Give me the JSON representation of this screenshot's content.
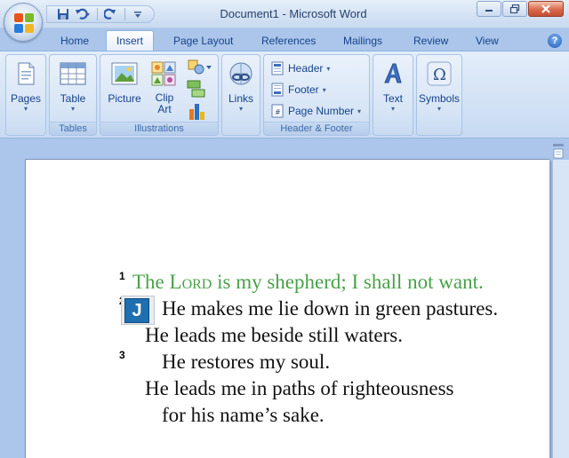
{
  "window": {
    "title": "Document1 - Microsoft Word"
  },
  "tabs": [
    {
      "label": "Home"
    },
    {
      "label": "Insert"
    },
    {
      "label": "Page Layout"
    },
    {
      "label": "References"
    },
    {
      "label": "Mailings"
    },
    {
      "label": "Review"
    },
    {
      "label": "View"
    }
  ],
  "active_tab": "Insert",
  "help": {
    "label": "?"
  },
  "ribbon": {
    "pages": {
      "label": "Pages"
    },
    "tables": {
      "table_label": "Table",
      "group_label": "Tables"
    },
    "illustrations": {
      "picture_label": "Picture",
      "clipart_line1": "Clip",
      "clipart_line2": "Art",
      "group_label": "Illustrations"
    },
    "links": {
      "label": "Links"
    },
    "header_footer": {
      "header_label": "Header",
      "footer_label": "Footer",
      "page_number_label": "Page Number",
      "group_label": "Header & Footer"
    },
    "text": {
      "label": "Text"
    },
    "symbols": {
      "label": "Symbols"
    }
  },
  "document": {
    "verse1_num": "1",
    "verse1_a": "The ",
    "verse1_lord": "Lord",
    "verse1_b": " is my shepherd; I shall not want.",
    "verse2_num": "2",
    "verse2_line1": "He makes me lie down in green pastures.",
    "verse2_line2": "He leads me beside still waters.",
    "verse3_num": "3",
    "verse3_line1": "He restores my soul.",
    "verse3_line2": "He leads me in paths of righteousness",
    "verse3_line3": "for his name’s sake."
  },
  "icons": {
    "ime_badge": "J"
  },
  "colors": {
    "verse1": "#4aa14a",
    "ime_badge": "#1f6fb0"
  }
}
